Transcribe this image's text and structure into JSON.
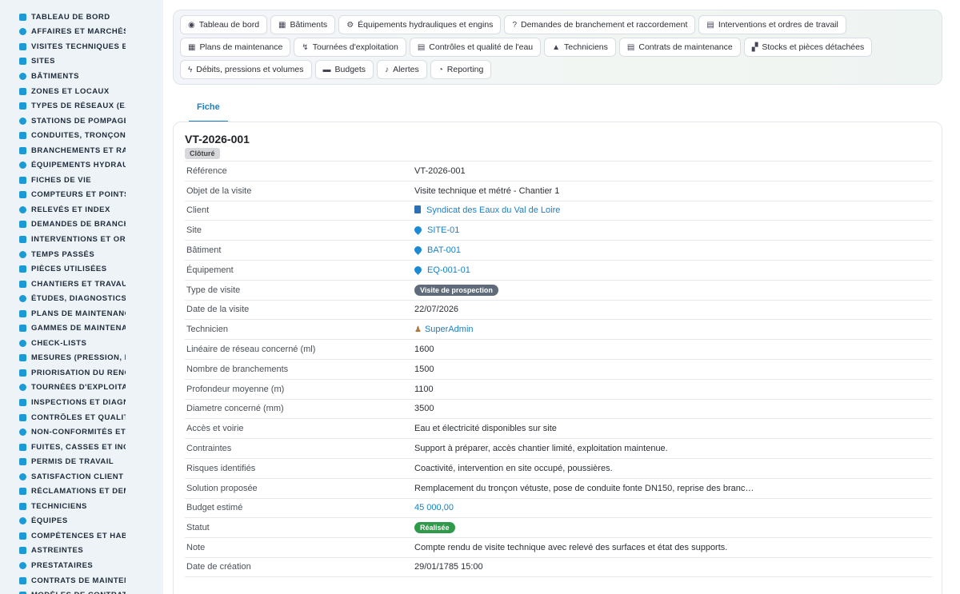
{
  "sidebar": {
    "items": [
      {
        "label": "TABLEAU DE BORD",
        "icon": "dashboard-icon"
      },
      {
        "label": "AFFAIRES ET MARCHÉS",
        "icon": "target-icon"
      },
      {
        "label": "VISITES TECHNIQUES ET",
        "icon": "ruler-icon"
      },
      {
        "label": "SITES",
        "icon": "pin-icon"
      },
      {
        "label": "BÂTIMENTS",
        "icon": "building-icon"
      },
      {
        "label": "ZONES ET LOCAUX",
        "icon": "zone-icon"
      },
      {
        "label": "TYPES DE RÉSEAUX (EAU",
        "icon": "network-icon"
      },
      {
        "label": "STATIONS DE POMPAGE I",
        "icon": "grid-icon"
      },
      {
        "label": "CONDUITES, TRONÇONS",
        "icon": "pipe-icon"
      },
      {
        "label": "BRANCHEMENTS ET RAC",
        "icon": "link-icon"
      },
      {
        "label": "ÉQUIPEMENTS HYDRAUL",
        "icon": "cogs-icon"
      },
      {
        "label": "FICHES DE VIE",
        "icon": "history-icon"
      },
      {
        "label": "COMPTEURS ET POINTS I",
        "icon": "gauge-icon"
      },
      {
        "label": "RELEVÉS ET INDEX",
        "icon": "list-icon"
      },
      {
        "label": "DEMANDES DE BRANCHE",
        "icon": "question-icon"
      },
      {
        "label": "INTERVENTIONS ET ORDI",
        "icon": "clipboard-icon"
      },
      {
        "label": "TEMPS PASSÉS",
        "icon": "clock-icon"
      },
      {
        "label": "PIÈCES UTILISÉES",
        "icon": "parts-icon"
      },
      {
        "label": "CHANTIERS ET TRAVAUX",
        "icon": "hammer-icon"
      },
      {
        "label": "ÉTUDES, DIAGNOSTICS E",
        "icon": "ruler-icon"
      },
      {
        "label": "PLANS DE MAINTENANCE",
        "icon": "calendar-icon"
      },
      {
        "label": "GAMMES DE MAINTENAN",
        "icon": "layers-icon"
      },
      {
        "label": "CHECK-LISTS",
        "icon": "checklist-icon"
      },
      {
        "label": "MESURES (PRESSION, DÉ",
        "icon": "thermometer-icon"
      },
      {
        "label": "PRIORISATION DU RENOU",
        "icon": "chart-icon"
      },
      {
        "label": "TOURNÉES D'EXPLOITATI",
        "icon": "route-icon"
      },
      {
        "label": "INSPECTIONS ET DIAGNC",
        "icon": "search-icon"
      },
      {
        "label": "CONTRÔLES ET QUALITÉ",
        "icon": "clipboard-check-icon"
      },
      {
        "label": "NON-CONFORMITÉS ET A",
        "icon": "alert-circle-icon"
      },
      {
        "label": "FUITES, CASSES ET INCI",
        "icon": "warning-icon"
      },
      {
        "label": "PERMIS DE TRAVAIL",
        "icon": "permit-icon"
      },
      {
        "label": "SATISFACTION CLIENT",
        "icon": "smile-icon"
      },
      {
        "label": "RÉCLAMATIONS ET DEMA",
        "icon": "comment-icon"
      },
      {
        "label": "TECHNICIENS",
        "icon": "hardhat-icon"
      },
      {
        "label": "ÉQUIPES",
        "icon": "users-icon"
      },
      {
        "label": "COMPÉTENCES ET HABIL",
        "icon": "certificate-icon"
      },
      {
        "label": "ASTREINTES",
        "icon": "phone-icon"
      },
      {
        "label": "PRESTATAIRES",
        "icon": "handshake-icon"
      },
      {
        "label": "CONTRATS DE MAINTENA",
        "icon": "contract-icon"
      },
      {
        "label": "MODÈLES DE CONTRATS",
        "icon": "template-icon"
      }
    ]
  },
  "menu": {
    "rows": [
      [
        {
          "label": "Tableau de bord",
          "icon": "dashboard-icon",
          "glyph": "◉"
        },
        {
          "label": "Bâtiments",
          "icon": "building-icon",
          "glyph": "▦"
        },
        {
          "label": "Équipements hydrauliques et engins",
          "icon": "cogs-icon",
          "glyph": "⚙"
        },
        {
          "label": "Demandes de branchement et raccordement",
          "icon": "question-icon",
          "glyph": "?"
        },
        {
          "label": "Interventions et ordres de travail",
          "icon": "clipboard-icon",
          "glyph": "▤"
        }
      ],
      [
        {
          "label": "Plans de maintenance",
          "icon": "calendar-icon",
          "glyph": "▦"
        },
        {
          "label": "Tournées d'exploitation",
          "icon": "route-icon",
          "glyph": "↯"
        },
        {
          "label": "Contrôles et qualité de l'eau",
          "icon": "clipboard-check-icon",
          "glyph": "▤"
        },
        {
          "label": "Techniciens",
          "icon": "hardhat-icon",
          "glyph": "▲"
        },
        {
          "label": "Contrats de maintenance",
          "icon": "contract-icon",
          "glyph": "▤"
        },
        {
          "label": "Stocks et pièces détachées",
          "icon": "boxes-icon",
          "glyph": "▞"
        }
      ],
      [
        {
          "label": "Débits, pressions et volumes",
          "icon": "bolt-icon",
          "glyph": "ϟ"
        },
        {
          "label": "Budgets",
          "icon": "money-icon",
          "glyph": "▬"
        },
        {
          "label": "Alertes",
          "icon": "bell-icon",
          "glyph": "♪"
        },
        {
          "label": "Reporting",
          "icon": "pie-icon",
          "glyph": "◔"
        }
      ]
    ]
  },
  "tabs": {
    "fiche": "Fiche"
  },
  "record": {
    "title": "VT-2026-001",
    "status_badge": "Clôturé",
    "fields": [
      {
        "key": "Référence",
        "value": "VT-2026-001",
        "kind": "text"
      },
      {
        "key": "Objet de la visite",
        "value": "Visite technique et métré - Chantier 1",
        "kind": "text"
      },
      {
        "key": "Client",
        "value": "Syndicat des Eaux du Val de Loire",
        "kind": "link",
        "icon": "building-icon"
      },
      {
        "key": "Site",
        "value": "SITE-01",
        "kind": "link",
        "icon": "water-drop-icon"
      },
      {
        "key": "Bâtiment",
        "value": "BAT-001",
        "kind": "link",
        "icon": "water-drop-icon"
      },
      {
        "key": "Équipement",
        "value": "EQ-001-01",
        "kind": "link",
        "icon": "water-drop-icon"
      },
      {
        "key": "Type de visite",
        "value": "Visite de prospection",
        "kind": "pill-gray"
      },
      {
        "key": "Date de la visite",
        "value": "22/07/2026",
        "kind": "text"
      },
      {
        "key": "Technicien",
        "value": "SuperAdmin",
        "kind": "link",
        "icon": "user-icon"
      },
      {
        "key": "Linéaire de réseau concerné (ml)",
        "value": "1600",
        "kind": "text"
      },
      {
        "key": "Nombre de branchements",
        "value": "1500",
        "kind": "text"
      },
      {
        "key": "Profondeur moyenne (m)",
        "value": "1100",
        "kind": "text"
      },
      {
        "key": "Diametre concerné (mm)",
        "value": "3500",
        "kind": "text"
      },
      {
        "key": "Accès et voirie",
        "value": "Eau et électricité disponibles sur site",
        "kind": "text"
      },
      {
        "key": "Contraintes",
        "value": "Support à préparer, accès chantier limité, exploitation maintenue.",
        "kind": "text"
      },
      {
        "key": "Risques identifiés",
        "value": "Coactivité, intervention en site occupé, poussières.",
        "kind": "text"
      },
      {
        "key": "Solution proposée",
        "value": "Remplacement du tronçon vétuste, pose de conduite fonte DN150, reprise des branc…",
        "kind": "text"
      },
      {
        "key": "Budget estimé",
        "value": "45 000,00",
        "kind": "link-plain"
      },
      {
        "key": "Statut",
        "value": "Réalisée",
        "kind": "pill-green"
      },
      {
        "key": "Note",
        "value": "Compte rendu de visite technique avec relevé des surfaces et état des supports.",
        "kind": "text"
      },
      {
        "key": "Date de création",
        "value": "29/01/1785 15:00",
        "kind": "text"
      }
    ]
  },
  "colors": {
    "accent": "#1a7fc4",
    "sidebar_bg": "#eef3f8",
    "sidebar_icon": "#1a9ad6",
    "pill_gray": "#5f6b7a",
    "pill_green": "#2f9a4a"
  }
}
